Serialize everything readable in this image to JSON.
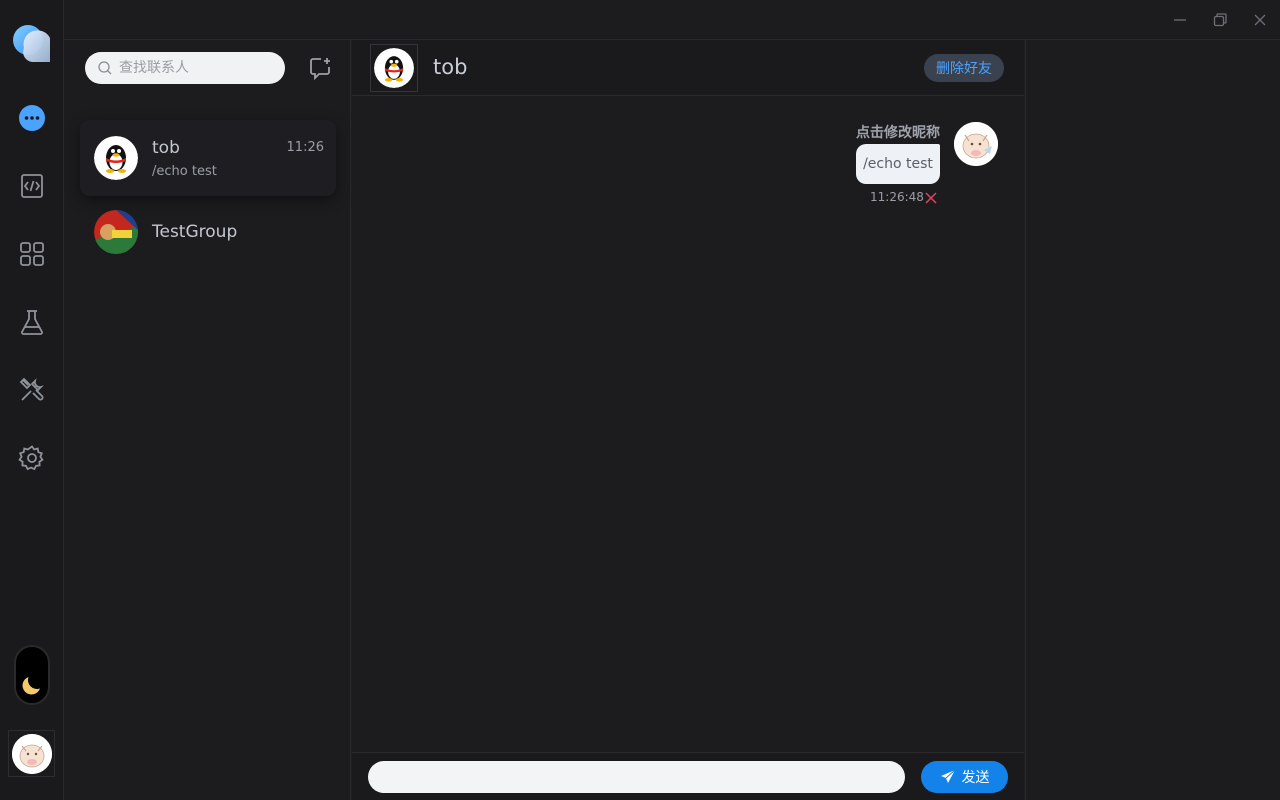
{
  "window": {
    "controls": [
      "minimize-icon",
      "restore-icon",
      "close-icon"
    ]
  },
  "rail": {
    "items": [
      "chat-icon",
      "code-icon",
      "apps-icon",
      "flask-icon",
      "tools-icon",
      "gear-icon"
    ],
    "active": "chat-icon",
    "theme": "moon-icon"
  },
  "contacts": {
    "search_placeholder": "查找联系人",
    "items": [
      {
        "name": "tob",
        "last_message": "/echo test",
        "time": "11:26"
      },
      {
        "name": "TestGroup",
        "last_message": "",
        "time": ""
      }
    ]
  },
  "chat": {
    "title": "tob",
    "delete_label": "删除好友",
    "messages": [
      {
        "nickname": "点击修改昵称",
        "text": "/echo test",
        "time": "11:26:48",
        "status": "failed"
      }
    ],
    "input_placeholder": "",
    "send_label": "发送"
  },
  "colors": {
    "accent": "#1483e9",
    "fail": "#e0455a",
    "background": "#1c1c1f"
  }
}
